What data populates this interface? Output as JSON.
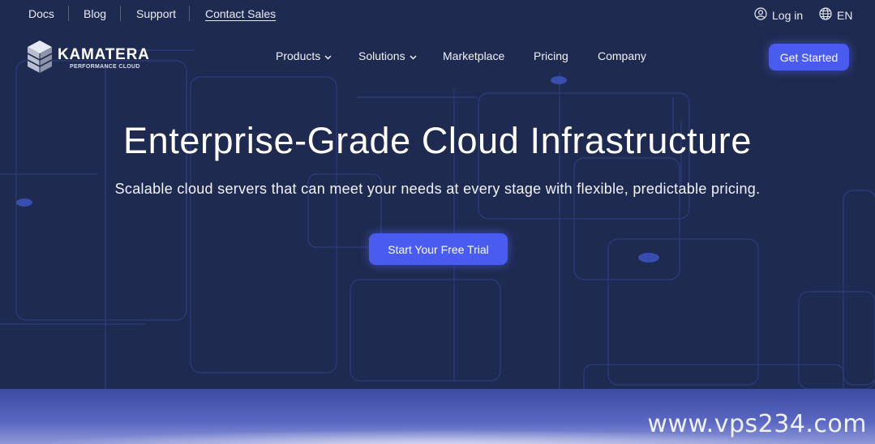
{
  "topbar": {
    "docs": "Docs",
    "blog": "Blog",
    "support": "Support",
    "contact_sales": "Contact Sales",
    "login": "Log in",
    "language": "EN"
  },
  "logo": {
    "name": "KAMATERA",
    "tagline": "PERFORMANCE CLOUD"
  },
  "nav": {
    "products": "Products",
    "solutions": "Solutions",
    "marketplace": "Marketplace",
    "pricing": "Pricing",
    "company": "Company",
    "get_started": "Get Started"
  },
  "hero": {
    "title": "Enterprise-Grade Cloud Infrastructure",
    "subtitle": "Scalable cloud servers that can meet your needs at every stage with flexible, predictable pricing.",
    "cta": "Start Your Free Trial"
  },
  "watermark": "www.vps234.com",
  "colors": {
    "background": "#1f2a50",
    "accent": "#4a5cf0",
    "line": "#3a4f9a"
  },
  "icons": {
    "login": "user-circle-icon",
    "language": "globe-icon",
    "dropdown": "chevron-down-icon",
    "logo": "cube-stack-icon",
    "decoration": "cloud-icon"
  }
}
